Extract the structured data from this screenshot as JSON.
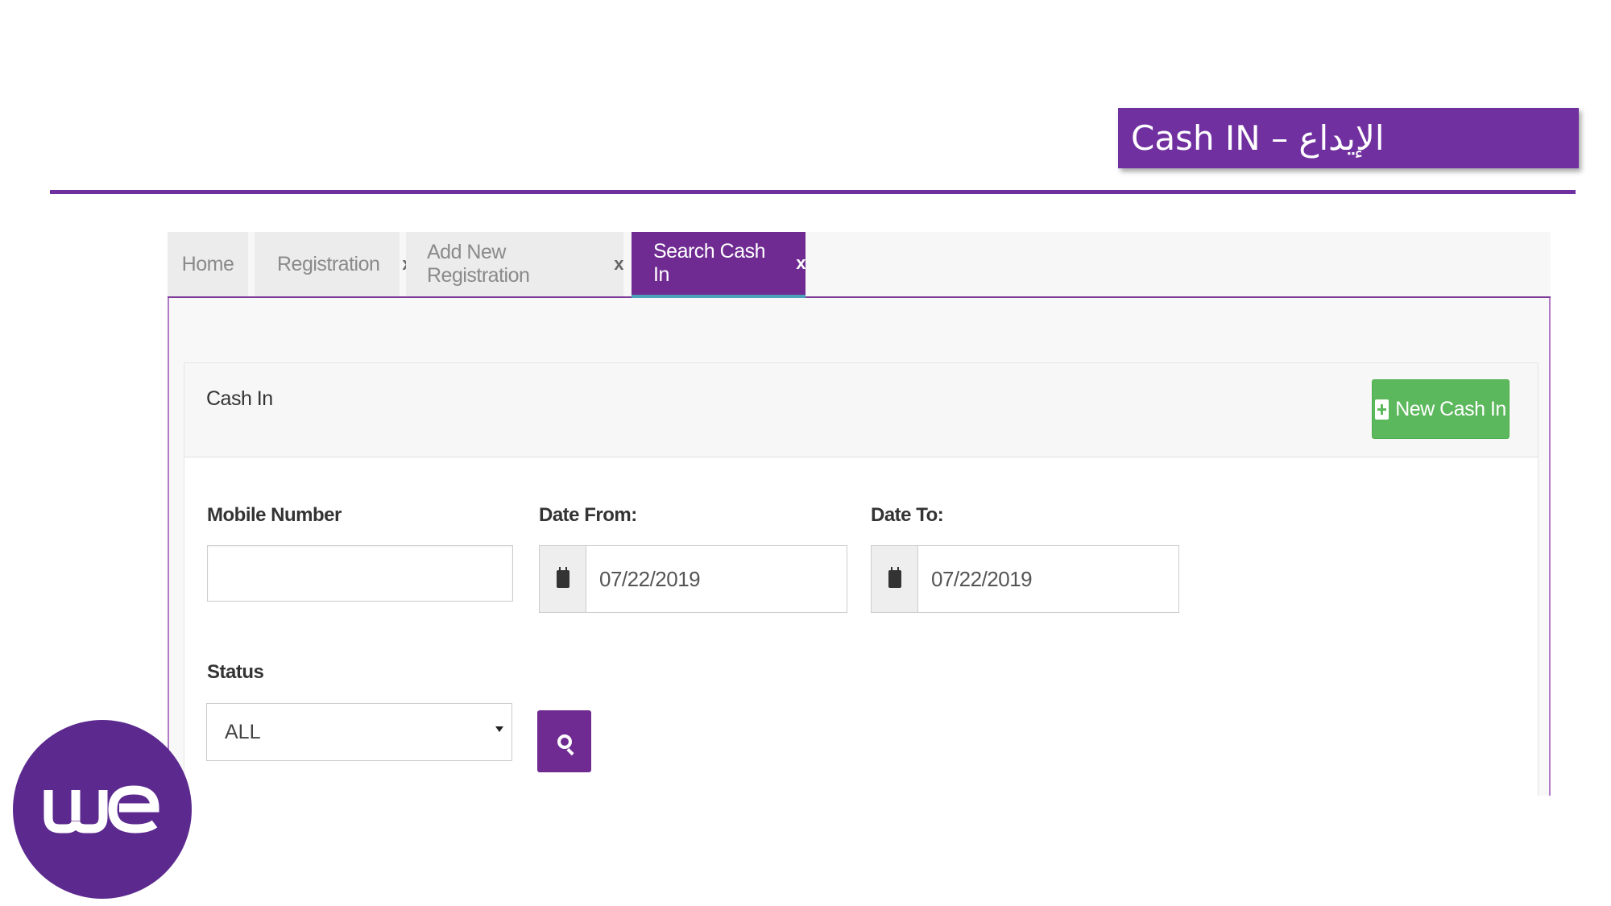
{
  "title_banner": {
    "text": "Cash IN – الإيداع"
  },
  "tabs": [
    {
      "label": "Home",
      "closable": false,
      "active": false
    },
    {
      "label": "Registration",
      "close": "x",
      "closable": true,
      "active": false
    },
    {
      "label": "Add New Registration",
      "close": "x",
      "closable": true,
      "active": false
    },
    {
      "label": "Search Cash In",
      "close": "x",
      "closable": true,
      "active": true
    }
  ],
  "panel": {
    "title": "Cash In",
    "new_button_label": "New Cash In"
  },
  "form": {
    "mobile_number": {
      "label": "Mobile Number",
      "value": ""
    },
    "date_from": {
      "label": "Date From:",
      "value": "07/22/2019"
    },
    "date_to": {
      "label": "Date To:",
      "value": "07/22/2019"
    },
    "status": {
      "label": "Status",
      "selected": "ALL"
    }
  },
  "icons": {
    "calendar": "calendar-icon",
    "search": "search-icon",
    "plus": "plus-square-icon",
    "caret": "caret-down-icon"
  },
  "logo": {
    "text": "we"
  },
  "colors": {
    "brand_purple": "#7030a0",
    "tab_active": "#6f2b91",
    "success_green": "#5cb85c",
    "logo_purple": "#5c2a8f"
  }
}
